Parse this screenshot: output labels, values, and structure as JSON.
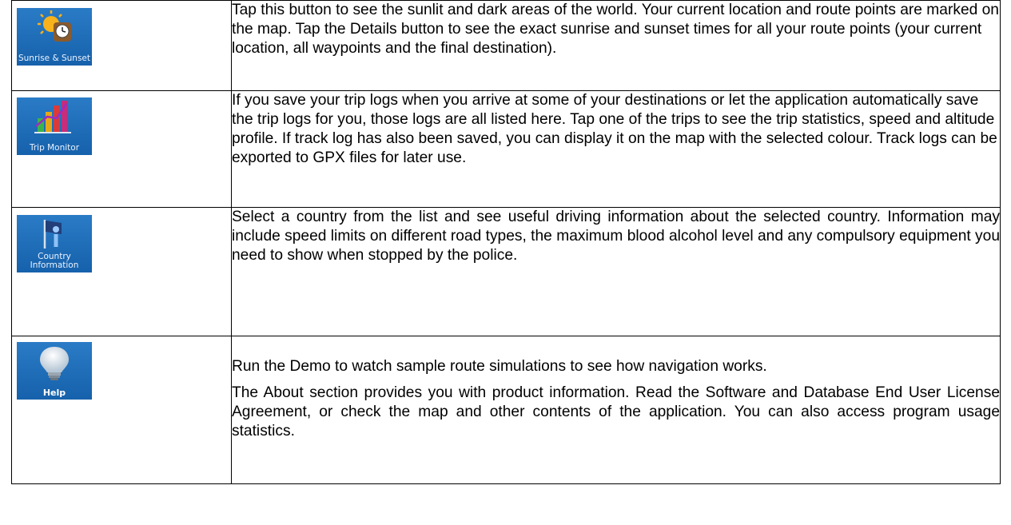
{
  "rows": [
    {
      "tile_label": "Sunrise & Sunset",
      "icon": "sunrise-sunset-icon",
      "text": "Tap this button to see the sunlit and dark areas of the world. Your current location and route points are marked on the map. Tap the Details button to see the exact sunrise and sunset times for all your route points (your current location, all waypoints and the final destination)."
    },
    {
      "tile_label": "Trip Monitor",
      "icon": "trip-monitor-icon",
      "text": "If you save your trip logs when you arrive at some of your destinations or let the application automatically save the trip logs for you, those logs are all listed here. Tap one of the trips to see the trip statistics, speed and altitude profile. If track log has also been saved, you can display it on the map with the selected colour. Track logs can be exported to GPX files for later use."
    },
    {
      "tile_label": "Country Information",
      "icon": "country-information-icon",
      "text": "Select a country from the list and see useful driving information about the selected country. Information may include speed limits on different road types, the maximum blood alcohol level and any compulsory equipment you need to show when stopped by the police."
    },
    {
      "tile_label": "Help",
      "icon": "help-lightbulb-icon",
      "paragraphs": [
        "Run the Demo to watch sample route simulations to see how navigation works.",
        "The About section provides you with product information. Read the Software and Database End User License Agreement, or check the map and other contents of the application. You can also access program usage statistics."
      ]
    }
  ],
  "colors": {
    "tile_blue": "#1a68b3",
    "border": "#000000"
  }
}
